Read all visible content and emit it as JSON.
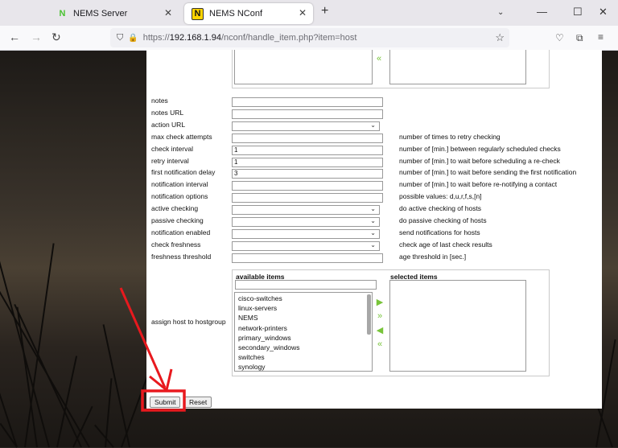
{
  "browser": {
    "tabs": [
      {
        "label": "NEMS Server",
        "active": false
      },
      {
        "label": "NEMS NConf",
        "active": true
      }
    ],
    "url_scheme": "https://",
    "url_host": "192.168.1.94",
    "url_path": "/nconf/handle_item.php?item=host"
  },
  "form": {
    "fields": [
      {
        "label": "notes",
        "kind": "input",
        "value": "",
        "desc": ""
      },
      {
        "label": "notes URL",
        "kind": "input",
        "value": "",
        "desc": ""
      },
      {
        "label": "action URL",
        "kind": "select",
        "value": "",
        "desc": ""
      },
      {
        "label": "max check attempts",
        "kind": "input",
        "value": "",
        "desc": "number of times to retry checking"
      },
      {
        "label": "check interval",
        "kind": "input",
        "value": "1",
        "desc": "number of [min.] between regularly scheduled checks"
      },
      {
        "label": "retry interval",
        "kind": "input",
        "value": "1",
        "desc": "number of [min.] to wait before scheduling a re-check"
      },
      {
        "label": "first notification delay",
        "kind": "input",
        "value": "3",
        "desc": "number of [min.] to wait before sending the first notification"
      },
      {
        "label": "notification interval",
        "kind": "input",
        "value": "",
        "desc": "number of [min.] to wait before re-notifying a contact"
      },
      {
        "label": "notification options",
        "kind": "input",
        "value": "",
        "desc": "possible values: d,u,r,f,s,[n]"
      },
      {
        "label": "active checking",
        "kind": "select",
        "value": "",
        "desc": "do active checking of hosts"
      },
      {
        "label": "passive checking",
        "kind": "select",
        "value": "",
        "desc": "do passive checking of hosts"
      },
      {
        "label": "notification enabled",
        "kind": "select",
        "value": "",
        "desc": "send notifications for hosts"
      },
      {
        "label": "check freshness",
        "kind": "select",
        "value": "",
        "desc": "check age of last check results"
      },
      {
        "label": "freshness threshold",
        "kind": "input",
        "value": "",
        "desc": "age threshold in [sec.]"
      }
    ],
    "hostgroup": {
      "label": "assign host to hostgroup",
      "available_title": "available items",
      "selected_title": "selected items",
      "available_items": [
        "cisco-switches",
        "linux-servers",
        "NEMS",
        "network-printers",
        "primary_windows",
        "secondary_windows",
        "switches",
        "synology"
      ]
    },
    "submit_label": "Submit",
    "reset_label": "Reset"
  },
  "colors": {
    "highlight": "#e8191e",
    "arrow_green": "#78c43a"
  }
}
